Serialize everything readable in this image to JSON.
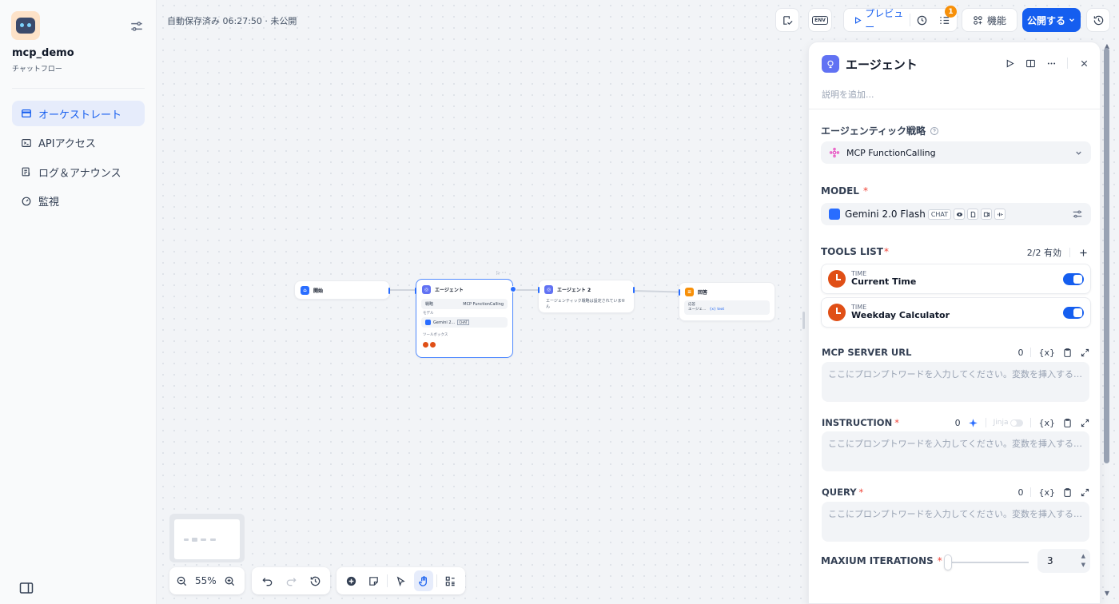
{
  "sidebar": {
    "app_name": "mcp_demo",
    "app_type": "チャットフロー",
    "nav": [
      {
        "label": "オーケストレート",
        "icon": "layout-icon",
        "active": true
      },
      {
        "label": "APIアクセス",
        "icon": "terminal-icon",
        "active": false
      },
      {
        "label": "ログ＆アナウンス",
        "icon": "log-icon",
        "active": false
      },
      {
        "label": "監視",
        "icon": "gauge-icon",
        "active": false
      }
    ]
  },
  "header": {
    "autosave": "自動保存済み 06:27:50 · 未公開",
    "env_label": "ENV",
    "preview_label": "プレビュー",
    "badge_count": "1",
    "features_label": "機能",
    "publish_label": "公開する"
  },
  "canvas": {
    "nodes": {
      "start": {
        "title": "開始"
      },
      "agent": {
        "title": "エージェント",
        "strategy_label": "戦略",
        "strategy_value": "MCP FunctionCalling",
        "model_label": "モデル",
        "model_value": "Gemini 2...",
        "model_chip": "CHAT",
        "toolbox_label": "ツールボックス"
      },
      "agent2": {
        "title": "エージェント 2",
        "status": "エージェンティック戦略は設定されていません"
      },
      "answer": {
        "title": "回答",
        "field_label": "応答",
        "ref_source": "エージェ...",
        "ref_var": "{x} text"
      }
    },
    "zoom": "55%"
  },
  "panel": {
    "title": "エージェント",
    "description_placeholder": "説明を追加...",
    "strategy_label": "エージェンティック戦略",
    "strategy_value": "MCP FunctionCalling",
    "model_label": "MODEL",
    "model_value": "Gemini 2.0 Flash",
    "model_chip": "CHAT",
    "tools_label": "TOOLS LIST",
    "tools_count": "2/2 有効",
    "tools": [
      {
        "provider": "TIME",
        "name": "Current Time",
        "enabled": true
      },
      {
        "provider": "TIME",
        "name": "Weekday Calculator",
        "enabled": true
      }
    ],
    "fields": [
      {
        "label": "MCP SERVER URL",
        "required": "",
        "count": "0",
        "placeholder": "ここにプロンプトワードを入力してください。変数を挿入するには「{」を、..."
      },
      {
        "label": "INSTRUCTION",
        "required": "*",
        "count": "0",
        "placeholder": "ここにプロンプトワードを入力してください。変数を挿入するには「{」を、..."
      },
      {
        "label": "QUERY",
        "required": "*",
        "count": "0",
        "placeholder": "ここにプロンプトワードを入力してください。変数を挿入するには「{」を、..."
      }
    ],
    "jinja_label": "Jinja",
    "var_label": "{x}",
    "iterations_label": "MAXIUM ITERATIONS",
    "iterations_value": "3",
    "iterations_fraction": 0.04
  },
  "colors": {
    "accent": "#155eef",
    "agent": "#6172f3",
    "tool": "#e04f16",
    "answer": "#f79009"
  }
}
